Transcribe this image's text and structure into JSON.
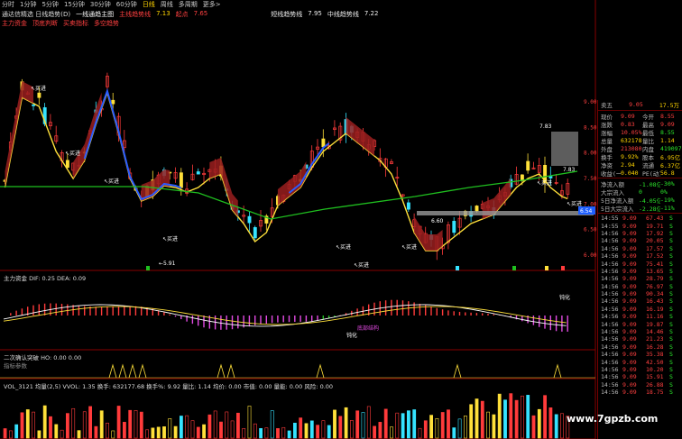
{
  "topbar": {
    "items": [
      "分时",
      "1分钟",
      "5分钟",
      "15分钟",
      "30分钟",
      "60分钟"
    ],
    "selected": "日线",
    "more": [
      "周线",
      "多周期",
      "更多>"
    ]
  },
  "header": {
    "line2": {
      "name": "通达信精选 日线趋势(D)",
      "mid": "一线通趋主图",
      "flag": "主线趋势线",
      "v1": "7.13",
      "v1_label": "起点",
      "v2": "7.65",
      "right_label": "短线趋势线",
      "right_v": "7.95",
      "right_label2": "中线趋势线",
      "right_v2": "7.22"
    },
    "line3": [
      "主力资金",
      "顶底判断",
      "买卖指标",
      "多空趋势"
    ]
  },
  "price_axis": [
    "9.00",
    "8.50",
    "8.00",
    "7.50",
    "7.00",
    "6.50",
    "6.00"
  ],
  "annotations": {
    "buy": "买进",
    "sell": "卖出",
    "low_label": "5.91",
    "mark_a": "7.83",
    "mark_b": "7.83",
    "mark_c": "6.60",
    "price_tag": "6.54"
  },
  "macd_pane": {
    "title": "主力资金 DIF: 0.25 DEA: 0.09",
    "label_a": "钝化",
    "label_b": "底部结构",
    "label_c": "钝化"
  },
  "signal_pane": {
    "title": "二次确认突破 HO: 0.00 0.00",
    "sub": "指标参数"
  },
  "vol_pane": {
    "title": "VOL_3121 均量(2,5) VVOL: 1.35 换手: 632177.68 换手%: 9.92 量比: 1.14 均价: 0.00 市值: 0.00 量能: 0.00 风险: 0.00"
  },
  "sidepanel": {
    "head": {
      "left": "卖五",
      "mid": "9.05",
      "right": "17.5万"
    },
    "rows": [
      {
        "l1": "现价",
        "v1": "9.09",
        "l2": "今开",
        "v2": "8.55"
      },
      {
        "l1": "涨跌",
        "v1": "0.83",
        "l2": "最高",
        "v2": "9.09"
      },
      {
        "l1": "涨幅",
        "v1": "10.05%",
        "l2": "最低",
        "v2": "8.55"
      },
      {
        "l1": "总量",
        "v1": "632178",
        "l2": "量比",
        "v2": "1.14"
      },
      {
        "l1": "外盘",
        "v1": "213080",
        "l2": "内盘",
        "v2": "419097"
      },
      {
        "l1": "换手",
        "v1": "9.92%",
        "l2": "股本",
        "v2": "6.95亿"
      },
      {
        "l1": "净资",
        "v1": "2.94",
        "l2": "流通",
        "v2": "6.37亿"
      },
      {
        "l1": "收益(一)",
        "v1": "0.040",
        "l2": "PE(动)",
        "v2": "56.8"
      }
    ],
    "flows": [
      {
        "label": "净流入额",
        "value": "-1.08亿",
        "pct": "-30%"
      },
      {
        "label": "大宗流入",
        "value": "0",
        "pct": "0%"
      },
      {
        "label": "5日净流入额",
        "value": "-4.05亿",
        "pct": "-19%"
      },
      {
        "label": "5日大宗流入",
        "value": "-2.28亿",
        "pct": "-11%"
      }
    ],
    "ticks": [
      {
        "t": "14:55",
        "p": "9.09",
        "v": "67.43",
        "d": "S"
      },
      {
        "t": "14:55",
        "p": "9.09",
        "v": "19.71",
        "d": "S"
      },
      {
        "t": "14:56",
        "p": "9.09",
        "v": "17.92",
        "d": "S"
      },
      {
        "t": "14:56",
        "p": "9.09",
        "v": "20.05",
        "d": "S"
      },
      {
        "t": "14:56",
        "p": "9.09",
        "v": "17.57",
        "d": "S"
      },
      {
        "t": "14:56",
        "p": "9.09",
        "v": "17.52",
        "d": "S"
      },
      {
        "t": "14:56",
        "p": "9.09",
        "v": "75.41",
        "d": "S"
      },
      {
        "t": "14:56",
        "p": "9.09",
        "v": "13.65",
        "d": "S"
      },
      {
        "t": "14:56",
        "p": "9.09",
        "v": "28.79",
        "d": "S"
      },
      {
        "t": "14:56",
        "p": "9.09",
        "v": "76.97",
        "d": "S"
      },
      {
        "t": "14:56",
        "p": "9.09",
        "v": "90.34",
        "d": "S"
      },
      {
        "t": "14:56",
        "p": "9.09",
        "v": "16.43",
        "d": "S"
      },
      {
        "t": "14:56",
        "p": "9.09",
        "v": "16.19",
        "d": "S"
      },
      {
        "t": "14:56",
        "p": "9.09",
        "v": "11.16",
        "d": "S"
      },
      {
        "t": "14:56",
        "p": "9.09",
        "v": "19.87",
        "d": "S"
      },
      {
        "t": "14:56",
        "p": "9.09",
        "v": "14.46",
        "d": "S"
      },
      {
        "t": "14:56",
        "p": "9.09",
        "v": "21.23",
        "d": "S"
      },
      {
        "t": "14:56",
        "p": "9.09",
        "v": "16.28",
        "d": "S"
      },
      {
        "t": "14:56",
        "p": "9.09",
        "v": "35.38",
        "d": "S"
      },
      {
        "t": "14:56",
        "p": "9.09",
        "v": "42.50",
        "d": "S"
      },
      {
        "t": "14:56",
        "p": "9.09",
        "v": "10.20",
        "d": "S"
      },
      {
        "t": "14:56",
        "p": "9.09",
        "v": "15.91",
        "d": "S"
      },
      {
        "t": "14:56",
        "p": "9.09",
        "v": "26.88",
        "d": "S"
      },
      {
        "t": "14:56",
        "p": "9.09",
        "v": "18.75",
        "d": "S"
      }
    ]
  },
  "watermark": "www.7gpzb.com"
}
